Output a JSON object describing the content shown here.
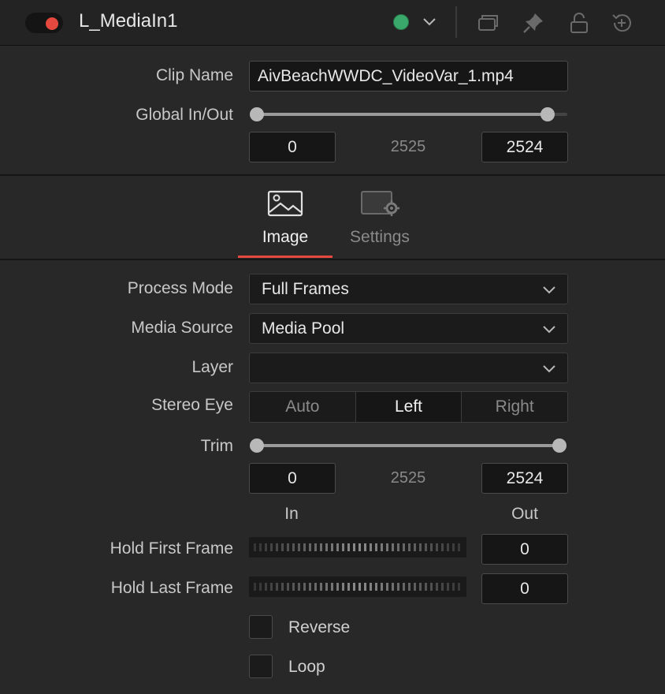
{
  "header": {
    "title": "L_MediaIn1",
    "icons": [
      "toggle-switch",
      "status-dot-icon",
      "chevron-down-icon",
      "versions-icon",
      "pin-icon",
      "lock-icon",
      "reset-icon"
    ],
    "status_color": "#3aa86a",
    "toggle_color": "#e5483e"
  },
  "clip": {
    "clip_name_label": "Clip Name",
    "clip_name_value": "AivBeachWWDC_VideoVar_1.mp4",
    "global_label": "Global In/Out",
    "global_in": "0",
    "global_mid": "2525",
    "global_out": "2524",
    "global_fill_fraction": 1.0
  },
  "tabs": [
    {
      "label": "Image",
      "icon": "image-icon",
      "active": true
    },
    {
      "label": "Settings",
      "icon": "settings-icon",
      "active": false
    }
  ],
  "image": {
    "process_mode_label": "Process Mode",
    "process_mode_value": "Full Frames",
    "media_source_label": "Media Source",
    "media_source_value": "Media Pool",
    "layer_label": "Layer",
    "layer_value": "",
    "stereo_label": "Stereo Eye",
    "stereo_options": [
      "Auto",
      "Left",
      "Right"
    ],
    "stereo_selected": "Left",
    "trim_label": "Trim",
    "trim_in": "0",
    "trim_mid": "2525",
    "trim_out": "2524",
    "in_label": "In",
    "out_label": "Out",
    "hold_first_label": "Hold First Frame",
    "hold_first_value": "0",
    "hold_last_label": "Hold Last Frame",
    "hold_last_value": "0",
    "reverse_label": "Reverse",
    "loop_label": "Loop"
  },
  "colors": {
    "accent": "#e5483e",
    "background": "#282828"
  }
}
